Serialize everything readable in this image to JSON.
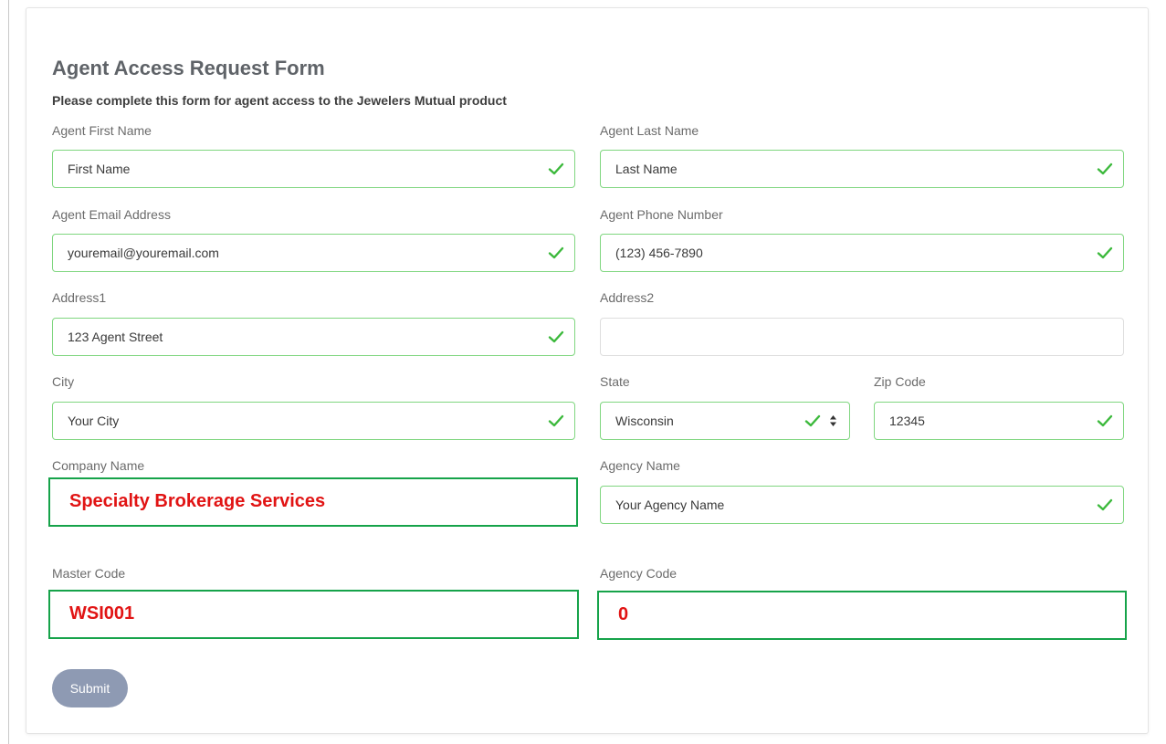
{
  "form": {
    "title": "Agent Access Request Form",
    "subtitle": "Please complete this form for agent access to the Jewelers Mutual product",
    "submit_label": "Submit",
    "fields": {
      "first_name": {
        "label": "Agent First Name",
        "value": "First Name"
      },
      "last_name": {
        "label": "Agent Last Name",
        "value": "Last Name"
      },
      "email": {
        "label": "Agent Email Address",
        "value": "youremail@youremail.com"
      },
      "phone": {
        "label": "Agent Phone Number",
        "value": "(123) 456-7890"
      },
      "address1": {
        "label": "Address1",
        "value": "123 Agent Street"
      },
      "address2": {
        "label": "Address2",
        "value": ""
      },
      "city": {
        "label": "City",
        "value": "Your City"
      },
      "state": {
        "label": "State",
        "value": "Wisconsin"
      },
      "zip": {
        "label": "Zip Code",
        "value": "12345"
      },
      "company_name": {
        "label": "Company Name",
        "value": "Specialty Brokerage Services"
      },
      "agency_name": {
        "label": "Agency Name",
        "value": "Your Agency Name"
      },
      "master_code": {
        "label": "Master Code",
        "value": "WSI001"
      },
      "agency_code": {
        "label": "Agency Code",
        "value": "0"
      }
    }
  },
  "colors": {
    "valid_border": "#7fd67f",
    "check": "#3cb93c",
    "highlight_border": "#16a34a",
    "highlight_text": "#e11414",
    "submit_bg": "#8e9ab3"
  },
  "icons": {
    "valid": "check-icon",
    "select": "sort-arrows-icon"
  }
}
